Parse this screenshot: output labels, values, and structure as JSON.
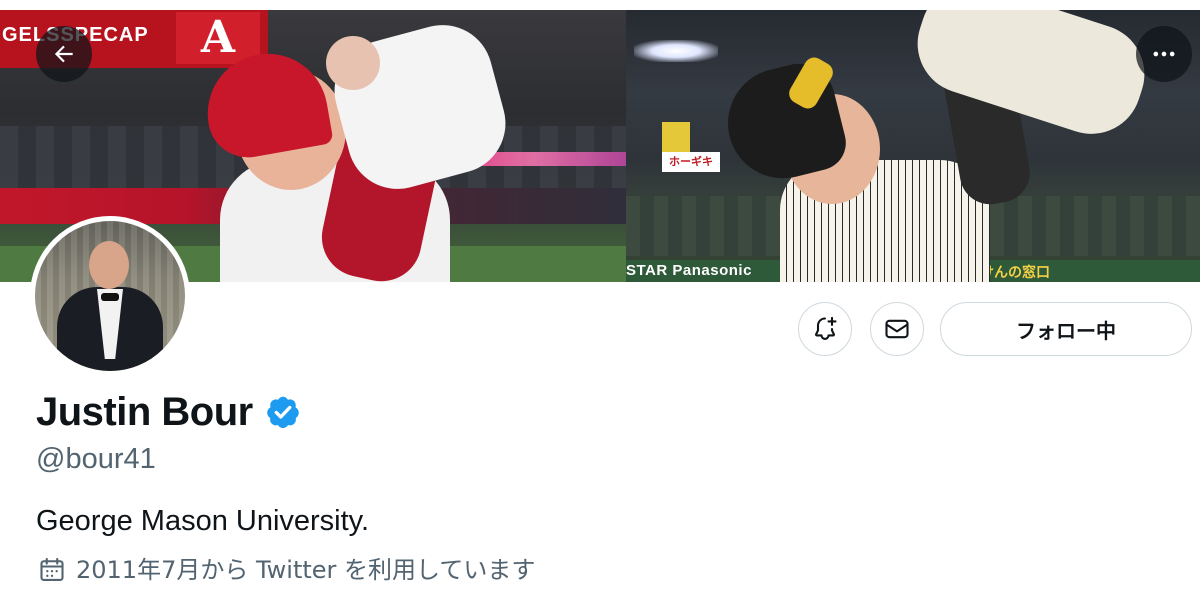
{
  "banner": {
    "left_ad_text": "GELSSPECAP",
    "left_logo_letter": "A",
    "right_board_text": "ホーギキ",
    "right_strip_text": "STAR Panasonic",
    "right_strip_text2": "ほけんの窓口"
  },
  "nav": {
    "back_icon": "back-arrow-icon",
    "more_icon": "more-dots-icon"
  },
  "profile": {
    "display_name": "Justin Bour",
    "verified": true,
    "handle": "@bour41",
    "bio": "George Mason University.",
    "joined": "2011年7月から Twitter を利用しています",
    "avatar_icon": "avatar"
  },
  "actions": {
    "notify_icon": "bell-plus-icon",
    "message_icon": "envelope-icon",
    "follow_label": "フォロー中"
  },
  "colors": {
    "primary_text": "#0f1419",
    "secondary_text": "#536471",
    "verified_blue": "#1d9bf0",
    "border": "#cfd9de"
  }
}
